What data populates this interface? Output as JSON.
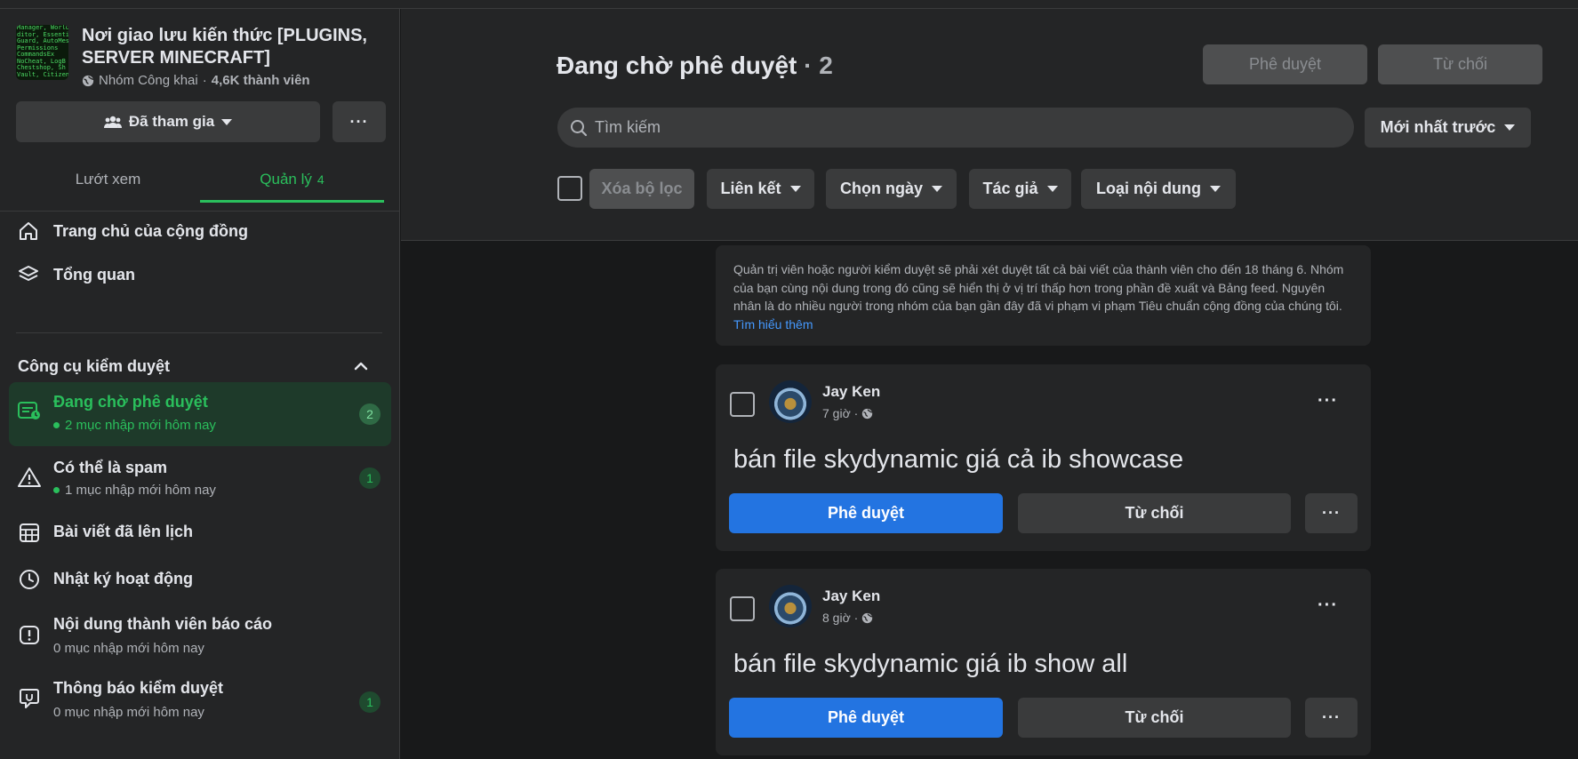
{
  "group": {
    "name": "Nơi giao lưu kiến thức [PLUGINS, SERVER MINECRAFT]",
    "privacy": "Nhóm Công khai",
    "separator": "·",
    "members": "4,6K thành viên",
    "thumb_lines": [
      "Manager, WorldE",
      "ditor, Essentials",
      "Guard, AutoMess",
      "Permissions",
      "CommandsEx",
      "NoCheat, LogB",
      "Chestshop, Sh",
      "Vault, Citizens"
    ]
  },
  "joined_button": {
    "label": "Đã tham gia"
  },
  "more_button": {
    "label": "···"
  },
  "tabs": [
    {
      "label": "Lướt xem"
    },
    {
      "label": "Quản lý",
      "count": "4"
    }
  ],
  "nav": [
    {
      "label": "Trang chủ của cộng đồng",
      "icon": "home-icon"
    },
    {
      "label": "Tổng quan",
      "icon": "layers-icon"
    }
  ],
  "moderation": {
    "section_title": "Công cụ kiểm duyệt",
    "items": [
      {
        "label": "Đang chờ phê duyệt",
        "sub": "2 mục nhập mới hôm nay",
        "badge": "2",
        "icon": "pending-posts-icon",
        "active": true
      },
      {
        "label": "Có thể là spam",
        "sub": "1 mục nhập mới hôm nay",
        "badge": "1",
        "icon": "warning-icon"
      },
      {
        "label": "Bài viết đã lên lịch",
        "sub": "",
        "badge": "",
        "icon": "calendar-icon"
      },
      {
        "label": "Nhật ký hoạt động",
        "sub": "",
        "badge": "",
        "icon": "clock-icon"
      },
      {
        "label": "Nội dung thành viên báo cáo",
        "sub": "0 mục nhập mới hôm nay",
        "badge": "",
        "icon": "report-icon"
      },
      {
        "label": "Thông báo kiểm duyệt",
        "sub": "0 mục nhập mới hôm nay",
        "badge": "1",
        "icon": "moderation-alert-icon"
      }
    ]
  },
  "header": {
    "title": "Đang chờ phê duyệt",
    "count": "· 2",
    "approve_label": "Phê duyệt",
    "reject_label": "Từ chối"
  },
  "search": {
    "placeholder": "Tìm kiếm"
  },
  "sort": {
    "label": "Mới nhất trước"
  },
  "filters": {
    "clear": "Xóa bộ lọc",
    "items": [
      "Liên kết",
      "Chọn ngày",
      "Tác giả",
      "Loại nội dung"
    ]
  },
  "notice": {
    "text": "Quản trị viên hoặc người kiểm duyệt sẽ phải xét duyệt tất cả bài viết của thành viên cho đến 18 tháng 6. Nhóm của bạn cùng nội dung trong đó cũng sẽ hiển thị ở vị trí thấp hơn trong phần đề xuất và Bảng feed. Nguyên nhân là do nhiều người trong nhóm của bạn gần đây đã vi phạm vi phạm Tiêu chuẩn cộng đồng của chúng tôi.",
    "link": "Tìm hiểu thêm"
  },
  "posts": [
    {
      "author": "Jay Ken",
      "time": "7 giờ ·",
      "text": "bán file skydynamic giá cả ib showcase",
      "approve": "Phê duyệt",
      "reject": "Từ chối",
      "more": "···"
    },
    {
      "author": "Jay Ken",
      "time": "8 giờ ·",
      "text": "bán file skydynamic giá ib show all",
      "approve": "Phê duyệt",
      "reject": "Từ chối",
      "more": "···"
    }
  ],
  "colors": {
    "accent_green": "#2abf5c",
    "primary_blue": "#2374e1",
    "link_blue": "#4599ff",
    "surface": "#242526",
    "background": "#18191a"
  }
}
